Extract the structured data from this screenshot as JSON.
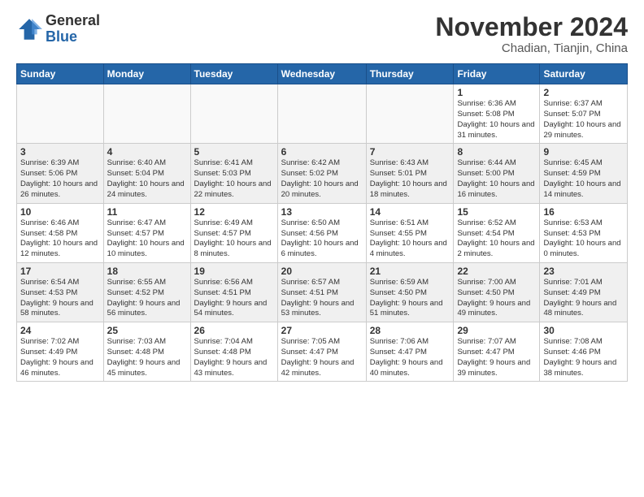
{
  "logo": {
    "general": "General",
    "blue": "Blue"
  },
  "header": {
    "title": "November 2024",
    "location": "Chadian, Tianjin, China"
  },
  "weekdays": [
    "Sunday",
    "Monday",
    "Tuesday",
    "Wednesday",
    "Thursday",
    "Friday",
    "Saturday"
  ],
  "weeks": [
    {
      "days": [
        {
          "date": "",
          "info": ""
        },
        {
          "date": "",
          "info": ""
        },
        {
          "date": "",
          "info": ""
        },
        {
          "date": "",
          "info": ""
        },
        {
          "date": "",
          "info": ""
        },
        {
          "date": "1",
          "info": "Sunrise: 6:36 AM\nSunset: 5:08 PM\nDaylight: 10 hours and 31 minutes."
        },
        {
          "date": "2",
          "info": "Sunrise: 6:37 AM\nSunset: 5:07 PM\nDaylight: 10 hours and 29 minutes."
        }
      ]
    },
    {
      "days": [
        {
          "date": "3",
          "info": "Sunrise: 6:39 AM\nSunset: 5:06 PM\nDaylight: 10 hours and 26 minutes."
        },
        {
          "date": "4",
          "info": "Sunrise: 6:40 AM\nSunset: 5:04 PM\nDaylight: 10 hours and 24 minutes."
        },
        {
          "date": "5",
          "info": "Sunrise: 6:41 AM\nSunset: 5:03 PM\nDaylight: 10 hours and 22 minutes."
        },
        {
          "date": "6",
          "info": "Sunrise: 6:42 AM\nSunset: 5:02 PM\nDaylight: 10 hours and 20 minutes."
        },
        {
          "date": "7",
          "info": "Sunrise: 6:43 AM\nSunset: 5:01 PM\nDaylight: 10 hours and 18 minutes."
        },
        {
          "date": "8",
          "info": "Sunrise: 6:44 AM\nSunset: 5:00 PM\nDaylight: 10 hours and 16 minutes."
        },
        {
          "date": "9",
          "info": "Sunrise: 6:45 AM\nSunset: 4:59 PM\nDaylight: 10 hours and 14 minutes."
        }
      ]
    },
    {
      "days": [
        {
          "date": "10",
          "info": "Sunrise: 6:46 AM\nSunset: 4:58 PM\nDaylight: 10 hours and 12 minutes."
        },
        {
          "date": "11",
          "info": "Sunrise: 6:47 AM\nSunset: 4:57 PM\nDaylight: 10 hours and 10 minutes."
        },
        {
          "date": "12",
          "info": "Sunrise: 6:49 AM\nSunset: 4:57 PM\nDaylight: 10 hours and 8 minutes."
        },
        {
          "date": "13",
          "info": "Sunrise: 6:50 AM\nSunset: 4:56 PM\nDaylight: 10 hours and 6 minutes."
        },
        {
          "date": "14",
          "info": "Sunrise: 6:51 AM\nSunset: 4:55 PM\nDaylight: 10 hours and 4 minutes."
        },
        {
          "date": "15",
          "info": "Sunrise: 6:52 AM\nSunset: 4:54 PM\nDaylight: 10 hours and 2 minutes."
        },
        {
          "date": "16",
          "info": "Sunrise: 6:53 AM\nSunset: 4:53 PM\nDaylight: 10 hours and 0 minutes."
        }
      ]
    },
    {
      "days": [
        {
          "date": "17",
          "info": "Sunrise: 6:54 AM\nSunset: 4:53 PM\nDaylight: 9 hours and 58 minutes."
        },
        {
          "date": "18",
          "info": "Sunrise: 6:55 AM\nSunset: 4:52 PM\nDaylight: 9 hours and 56 minutes."
        },
        {
          "date": "19",
          "info": "Sunrise: 6:56 AM\nSunset: 4:51 PM\nDaylight: 9 hours and 54 minutes."
        },
        {
          "date": "20",
          "info": "Sunrise: 6:57 AM\nSunset: 4:51 PM\nDaylight: 9 hours and 53 minutes."
        },
        {
          "date": "21",
          "info": "Sunrise: 6:59 AM\nSunset: 4:50 PM\nDaylight: 9 hours and 51 minutes."
        },
        {
          "date": "22",
          "info": "Sunrise: 7:00 AM\nSunset: 4:50 PM\nDaylight: 9 hours and 49 minutes."
        },
        {
          "date": "23",
          "info": "Sunrise: 7:01 AM\nSunset: 4:49 PM\nDaylight: 9 hours and 48 minutes."
        }
      ]
    },
    {
      "days": [
        {
          "date": "24",
          "info": "Sunrise: 7:02 AM\nSunset: 4:49 PM\nDaylight: 9 hours and 46 minutes."
        },
        {
          "date": "25",
          "info": "Sunrise: 7:03 AM\nSunset: 4:48 PM\nDaylight: 9 hours and 45 minutes."
        },
        {
          "date": "26",
          "info": "Sunrise: 7:04 AM\nSunset: 4:48 PM\nDaylight: 9 hours and 43 minutes."
        },
        {
          "date": "27",
          "info": "Sunrise: 7:05 AM\nSunset: 4:47 PM\nDaylight: 9 hours and 42 minutes."
        },
        {
          "date": "28",
          "info": "Sunrise: 7:06 AM\nSunset: 4:47 PM\nDaylight: 9 hours and 40 minutes."
        },
        {
          "date": "29",
          "info": "Sunrise: 7:07 AM\nSunset: 4:47 PM\nDaylight: 9 hours and 39 minutes."
        },
        {
          "date": "30",
          "info": "Sunrise: 7:08 AM\nSunset: 4:46 PM\nDaylight: 9 hours and 38 minutes."
        }
      ]
    }
  ]
}
